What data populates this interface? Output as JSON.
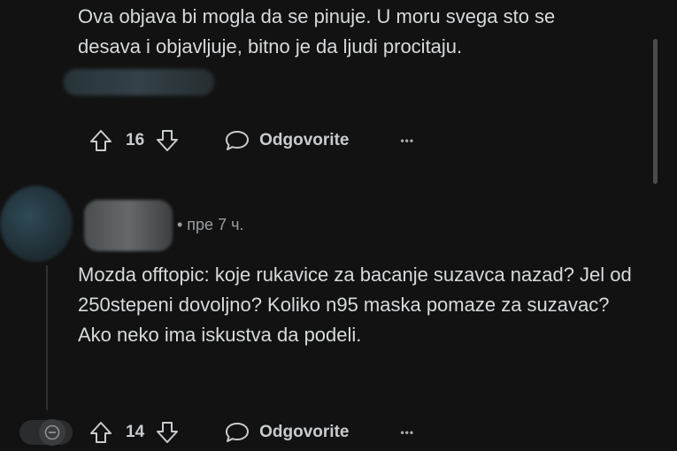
{
  "comment1": {
    "text": "Ova objava bi mogla da se pinuje. U moru svega sto se desava i objavljuje, bitno je da ljudi procitaju.",
    "votes": "16",
    "reply_label": "Odgovorite",
    "more_label": "•••"
  },
  "comment2": {
    "meta": "• пре 7 ч.",
    "text": "Mozda offtopic: koje rukavice za bacanje suzavca nazad? Jel od 250stepeni dovoljno? Koliko n95 maska pomaze za suzavac? Ako neko ima iskustva da podeli.",
    "votes": "14",
    "reply_label": "Odgovorite",
    "more_label": "•••"
  },
  "colors": {
    "background": "#121212",
    "text": "#d7dadc",
    "muted": "#9a9ea1"
  }
}
